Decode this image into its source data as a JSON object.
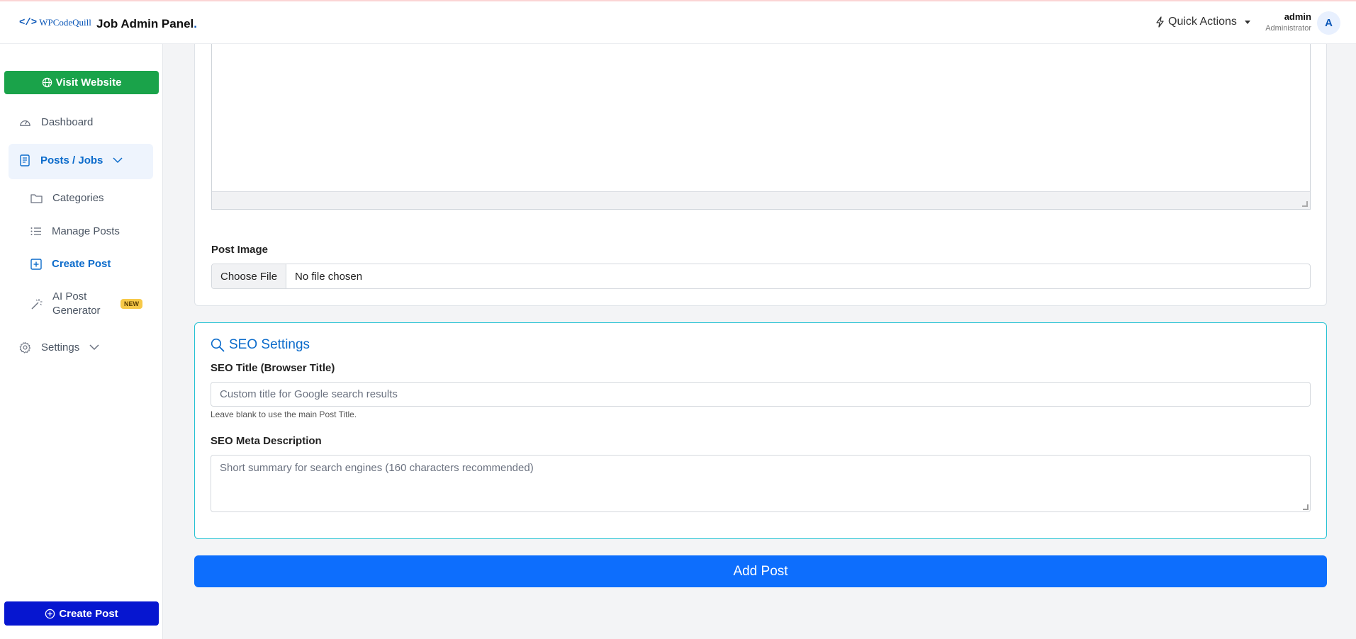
{
  "header": {
    "logo_text": "WPCodeQuill",
    "logo_code": "</>",
    "title": "Job Admin Panel",
    "title_dot": ".",
    "quick_actions": "Quick Actions",
    "user_name": "admin",
    "user_role": "Administrator",
    "avatar_initial": "A"
  },
  "sidebar": {
    "visit_website": "Visit Website",
    "items": {
      "dashboard": "Dashboard",
      "posts_jobs": "Posts / Jobs",
      "categories": "Categories",
      "manage_posts": "Manage Posts",
      "create_post": "Create Post",
      "ai_post_generator_line1": "AI Post",
      "ai_post_generator_line2": "Generator",
      "ai_badge": "NEW",
      "settings": "Settings"
    },
    "create_post_button": "Create Post"
  },
  "main": {
    "post_image_label": "Post Image",
    "choose_file": "Choose File",
    "no_file": "No file chosen",
    "seo": {
      "heading": "SEO Settings",
      "title_label": "SEO Title (Browser Title)",
      "title_placeholder": "Custom title for Google search results",
      "title_hint": "Leave blank to use the main Post Title.",
      "meta_label": "SEO Meta Description",
      "meta_placeholder": "Short summary for search engines (160 characters recommended)"
    },
    "add_post": "Add Post"
  },
  "colors": {
    "accent": "#0d6efd",
    "visit_green": "#1aa34a",
    "create_blue": "#0616d0",
    "seo_border": "#26c2d3"
  }
}
